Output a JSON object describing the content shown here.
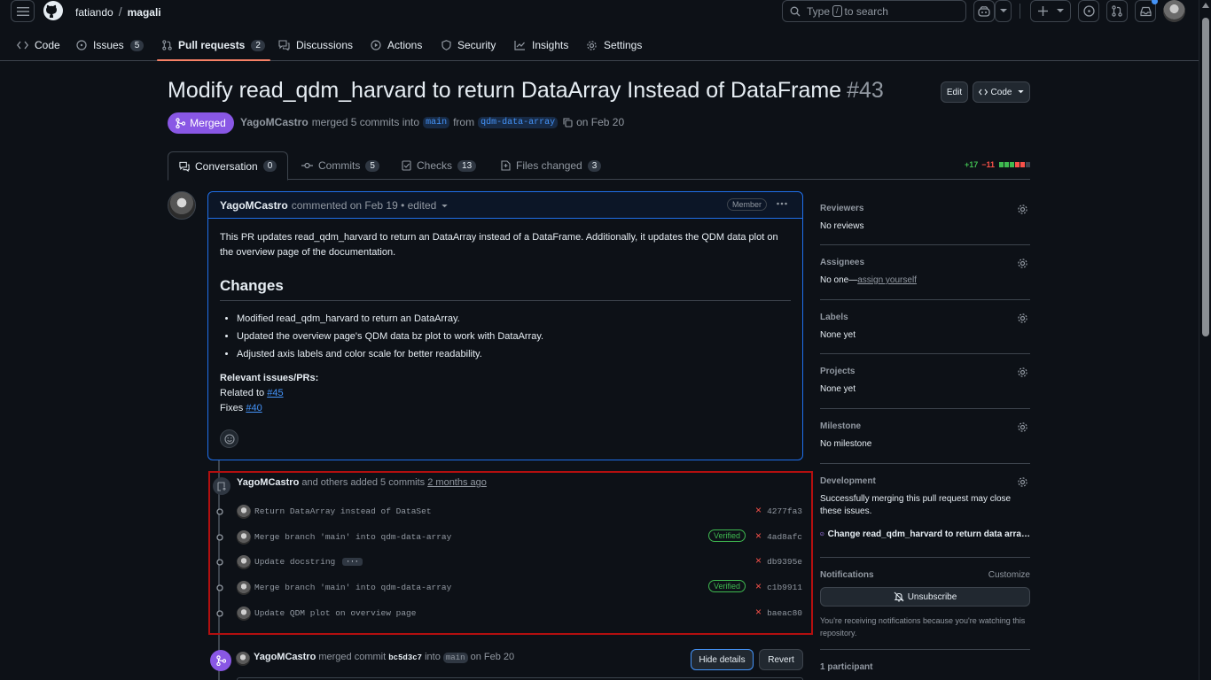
{
  "header": {
    "owner": "fatiando",
    "repo": "magali",
    "search_prefix": "Type",
    "search_key": "/",
    "search_suffix": "to search"
  },
  "repo_nav": [
    {
      "label": "Code",
      "count": "",
      "icon": "code-icon"
    },
    {
      "label": "Issues",
      "count": "5",
      "icon": "issue-icon"
    },
    {
      "label": "Pull requests",
      "count": "2",
      "icon": "pull-request-icon"
    },
    {
      "label": "Discussions",
      "count": "",
      "icon": "discussion-icon"
    },
    {
      "label": "Actions",
      "count": "",
      "icon": "play-icon"
    },
    {
      "label": "Security",
      "count": "",
      "icon": "shield-icon"
    },
    {
      "label": "Insights",
      "count": "",
      "icon": "graph-icon"
    },
    {
      "label": "Settings",
      "count": "",
      "icon": "gear-icon"
    }
  ],
  "pr": {
    "title": "Modify read_qdm_harvard to return DataArray Instead of DataFrame",
    "number": "#43",
    "edit_label": "Edit",
    "code_label": "Code",
    "state": "Merged",
    "author": "YagoMCastro",
    "merged_text": "merged 5 commits into",
    "base_branch": "main",
    "from_text": "from",
    "head_branch": "qdm-data-array",
    "date_text": "on Feb 20"
  },
  "tabs": [
    {
      "label": "Conversation",
      "count": "0"
    },
    {
      "label": "Commits",
      "count": "5"
    },
    {
      "label": "Checks",
      "count": "13"
    },
    {
      "label": "Files changed",
      "count": "3"
    }
  ],
  "diffstat": {
    "additions": "+17",
    "deletions": "−11"
  },
  "comment": {
    "author": "YagoMCastro",
    "meta": "commented on Feb 19 • edited",
    "role": "Member",
    "intro": "This PR updates read_qdm_harvard to return an DataArray instead of a DataFrame. Additionally, it updates the QDM data plot on the overview page of the documentation.",
    "heading": "Changes",
    "bullets": [
      "Modified read_qdm_harvard to return an DataArray.",
      "Updated the overview page's QDM data bz plot to work with DataArray.",
      "Adjusted axis labels and color scale for better readability."
    ],
    "relevant_label": "Relevant issues/PRs:",
    "related_text": "Related to",
    "related_link": "#45",
    "fixes_text": "Fixes",
    "fixes_link": "#40"
  },
  "commit_event": {
    "author": "YagoMCastro",
    "text": "and others added 5 commits",
    "time": "2 months ago",
    "commits": [
      {
        "message": "Return DataArray instead of DataSet",
        "verified": "",
        "sha": "4277fa3",
        "status": "×"
      },
      {
        "message": "Merge branch 'main' into qdm-data-array",
        "verified": "Verified",
        "sha": "4ad8afc",
        "status": "×"
      },
      {
        "message": "Update docstring",
        "verified": "",
        "sha": "db9395e",
        "status": "×",
        "more": "···"
      },
      {
        "message": "Merge branch 'main' into qdm-data-array",
        "verified": "Verified",
        "sha": "c1b9911",
        "status": "×"
      },
      {
        "message": "Update QDM plot on overview page",
        "verified": "",
        "sha": "baeac80",
        "status": "×"
      }
    ]
  },
  "merge_event": {
    "author": "YagoMCastro",
    "text": "merged commit",
    "sha": "bc5d3c7",
    "into": "into",
    "branch": "main",
    "date": "on Feb 20",
    "hide_label": "Hide details",
    "revert_label": "Revert"
  },
  "sidebar": {
    "reviewers_title": "Reviewers",
    "reviewers_value": "No reviews",
    "assignees_title": "Assignees",
    "assignees_prefix": "No one—",
    "assignees_link": "assign yourself",
    "labels_title": "Labels",
    "labels_value": "None yet",
    "projects_title": "Projects",
    "projects_value": "None yet",
    "milestone_title": "Milestone",
    "milestone_value": "No milestone",
    "development_title": "Development",
    "development_value": "Successfully merging this pull request may close these issues.",
    "development_issue": "Change read_qdm_harvard to return data arra…",
    "notifications_title": "Notifications",
    "customize_label": "Customize",
    "unsubscribe_label": "Unsubscribe",
    "notifications_note": "You're receiving notifications because you're watching this repository.",
    "participants": "1 participant"
  },
  "colors": {
    "accent": "#4493f8",
    "merged": "#8957e5",
    "danger": "#f85149",
    "success": "#3fb950",
    "highlight_border": "#b30f0f"
  }
}
